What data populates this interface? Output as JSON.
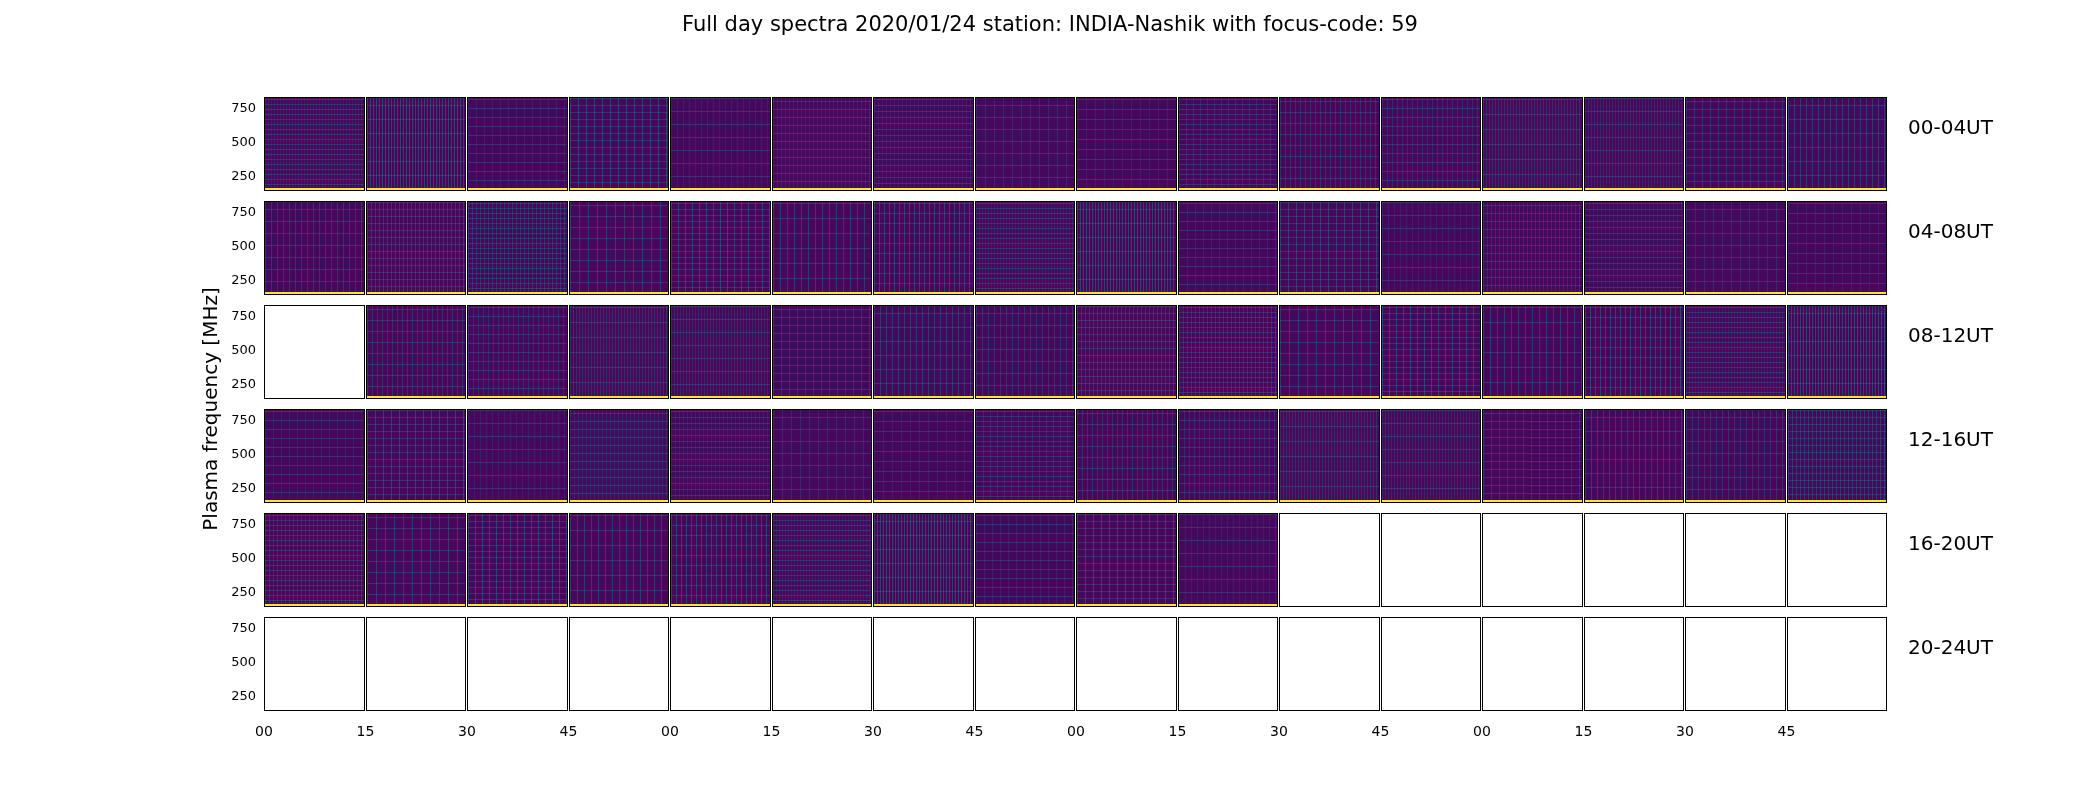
{
  "title": "Full day spectra 2020/01/24 station: INDIA-Nashik with focus-code: 59",
  "ylabel": "Plasma frequency [MHz]",
  "xticks": [
    "00",
    "15",
    "30",
    "45",
    "00",
    "15",
    "30",
    "45",
    "00",
    "15",
    "30",
    "45",
    "00",
    "15",
    "30",
    "45"
  ],
  "rows": [
    {
      "label": "00-04UT",
      "yticks": [
        "750",
        "500",
        "250"
      ],
      "panels": [
        {
          "kind": "spectrum"
        },
        {
          "kind": "spectrum"
        },
        {
          "kind": "spectrum"
        },
        {
          "kind": "spectrum"
        },
        {
          "kind": "spectrum"
        },
        {
          "kind": "spectrum"
        },
        {
          "kind": "spectrum"
        },
        {
          "kind": "spectrum"
        },
        {
          "kind": "spectrum"
        },
        {
          "kind": "spectrum"
        },
        {
          "kind": "spectrum"
        },
        {
          "kind": "spectrum"
        },
        {
          "kind": "spectrum"
        },
        {
          "kind": "spectrum"
        },
        {
          "kind": "spectrum"
        },
        {
          "kind": "spectrum"
        }
      ]
    },
    {
      "label": "04-08UT",
      "yticks": [
        "750",
        "500",
        "250"
      ],
      "panels": [
        {
          "kind": "spectrum"
        },
        {
          "kind": "spectrum"
        },
        {
          "kind": "spectrum"
        },
        {
          "kind": "spectrum"
        },
        {
          "kind": "spectrum"
        },
        {
          "kind": "spectrum"
        },
        {
          "kind": "spectrum"
        },
        {
          "kind": "spectrum"
        },
        {
          "kind": "spectrum"
        },
        {
          "kind": "spectrum"
        },
        {
          "kind": "spectrum"
        },
        {
          "kind": "spectrum"
        },
        {
          "kind": "spectrum"
        },
        {
          "kind": "spectrum"
        },
        {
          "kind": "spectrum"
        },
        {
          "kind": "spectrum"
        }
      ]
    },
    {
      "label": "08-12UT",
      "yticks": [
        "750",
        "500",
        "250"
      ],
      "panels": [
        {
          "kind": "empty"
        },
        {
          "kind": "spectrum"
        },
        {
          "kind": "spectrum"
        },
        {
          "kind": "spectrum"
        },
        {
          "kind": "spectrum"
        },
        {
          "kind": "spectrum"
        },
        {
          "kind": "spectrum"
        },
        {
          "kind": "spectrum"
        },
        {
          "kind": "spectrum"
        },
        {
          "kind": "spectrum"
        },
        {
          "kind": "spectrum"
        },
        {
          "kind": "spectrum"
        },
        {
          "kind": "spectrum"
        },
        {
          "kind": "spectrum"
        },
        {
          "kind": "spectrum"
        },
        {
          "kind": "spectrum"
        }
      ]
    },
    {
      "label": "12-16UT",
      "yticks": [
        "750",
        "500",
        "250"
      ],
      "panels": [
        {
          "kind": "spectrum"
        },
        {
          "kind": "spectrum"
        },
        {
          "kind": "spectrum"
        },
        {
          "kind": "spectrum"
        },
        {
          "kind": "spectrum"
        },
        {
          "kind": "spectrum"
        },
        {
          "kind": "spectrum"
        },
        {
          "kind": "spectrum"
        },
        {
          "kind": "spectrum"
        },
        {
          "kind": "spectrum"
        },
        {
          "kind": "spectrum"
        },
        {
          "kind": "spectrum"
        },
        {
          "kind": "spectrum"
        },
        {
          "kind": "spectrum"
        },
        {
          "kind": "spectrum"
        },
        {
          "kind": "spectrum"
        }
      ]
    },
    {
      "label": "16-20UT",
      "yticks": [
        "750",
        "500",
        "250"
      ],
      "panels": [
        {
          "kind": "spectrum"
        },
        {
          "kind": "spectrum"
        },
        {
          "kind": "spectrum"
        },
        {
          "kind": "spectrum"
        },
        {
          "kind": "spectrum"
        },
        {
          "kind": "spectrum"
        },
        {
          "kind": "spectrum"
        },
        {
          "kind": "spectrum"
        },
        {
          "kind": "spectrum"
        },
        {
          "kind": "spectrum"
        },
        {
          "kind": "empty"
        },
        {
          "kind": "empty"
        },
        {
          "kind": "empty"
        },
        {
          "kind": "empty"
        },
        {
          "kind": "empty"
        },
        {
          "kind": "empty"
        }
      ]
    },
    {
      "label": "20-24UT",
      "yticks": [
        "750",
        "500",
        "250"
      ],
      "panels": [
        {
          "kind": "empty"
        },
        {
          "kind": "empty"
        },
        {
          "kind": "empty"
        },
        {
          "kind": "empty"
        },
        {
          "kind": "empty"
        },
        {
          "kind": "empty"
        },
        {
          "kind": "empty"
        },
        {
          "kind": "empty"
        },
        {
          "kind": "empty"
        },
        {
          "kind": "empty"
        },
        {
          "kind": "empty"
        },
        {
          "kind": "empty"
        },
        {
          "kind": "empty"
        },
        {
          "kind": "empty"
        },
        {
          "kind": "empty"
        },
        {
          "kind": "empty"
        }
      ]
    }
  ]
}
